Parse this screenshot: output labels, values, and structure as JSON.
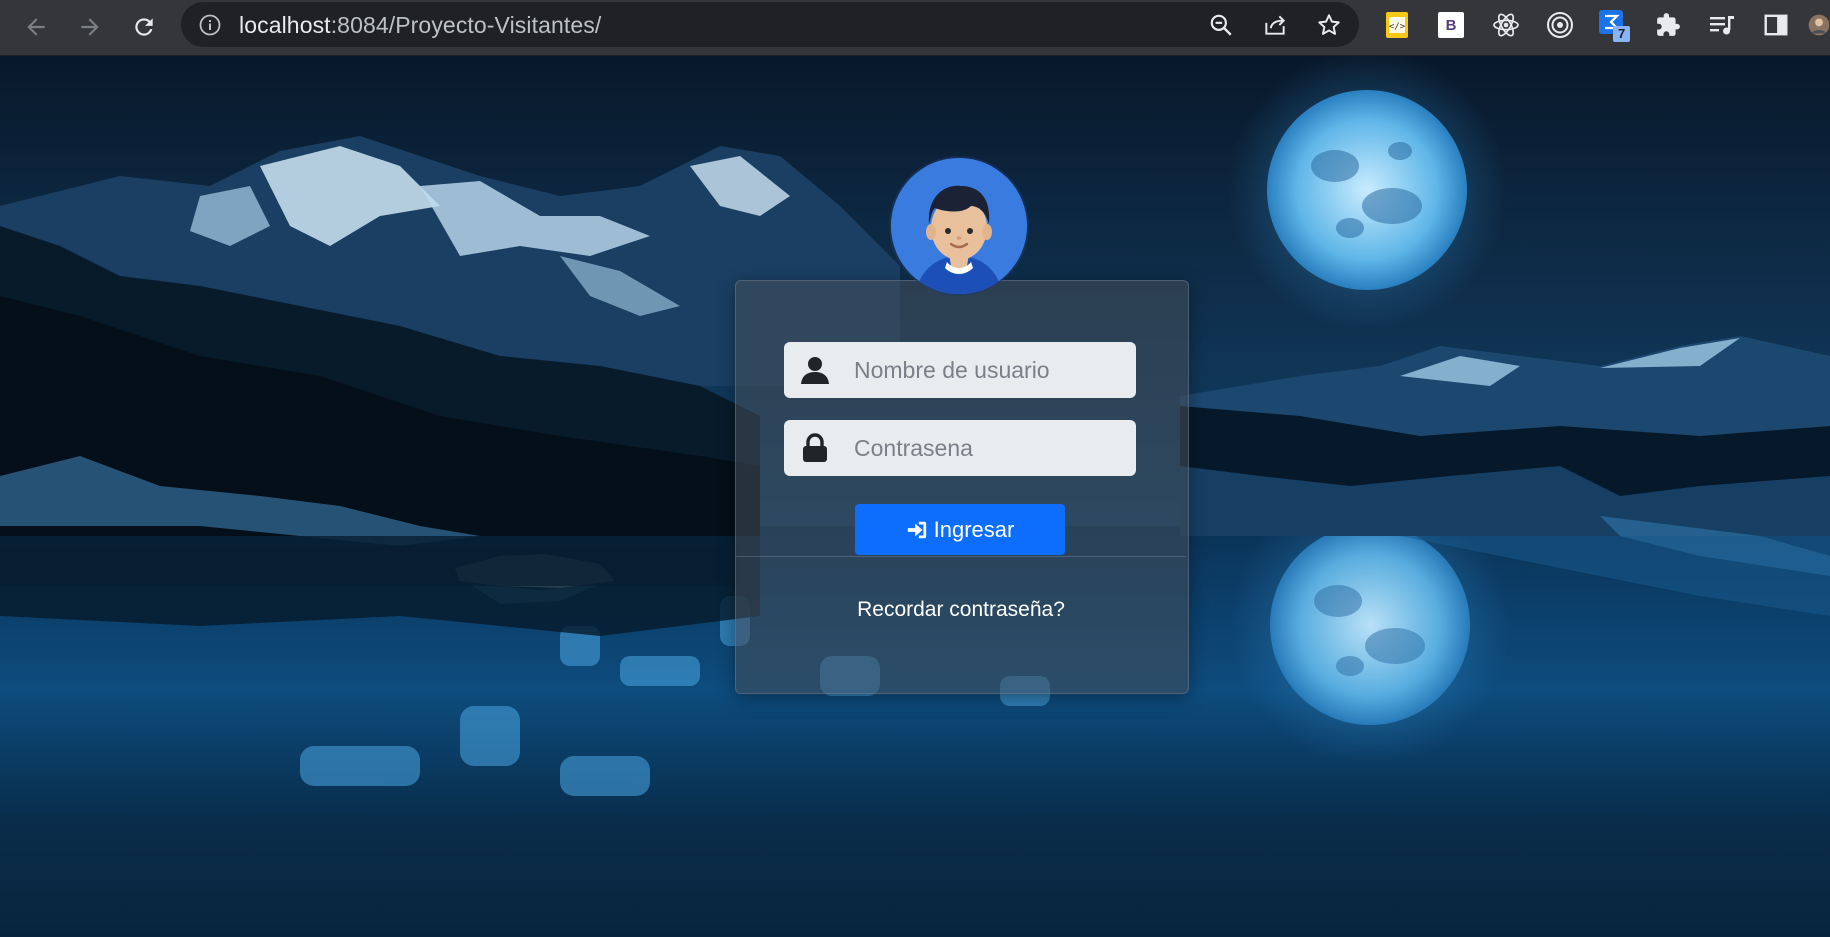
{
  "browser": {
    "url_host": "localhost",
    "url_path": ":8084/Proyecto-Visitantes/",
    "badge_count": "7",
    "bootstrap_ext_letter": "B",
    "nav": {
      "back_icon": "arrow-left-icon",
      "forward_icon": "arrow-right-icon",
      "reload_icon": "reload-icon"
    },
    "omnibox_actions": [
      "zoom-out-icon",
      "share-icon",
      "star-icon"
    ],
    "extensions": [
      "code-extension-icon",
      "bootstrap-extension-icon",
      "react-devtools-icon",
      "target-extension-icon",
      "badge-extension-icon",
      "puzzle-extensions-icon",
      "media-control-icon",
      "side-panel-icon",
      "profile-avatar-icon"
    ]
  },
  "login": {
    "username_placeholder": "Nombre de usuario",
    "password_placeholder": "Contrasena",
    "submit_label": "Ingresar",
    "forgot_label": "Recordar contraseña?",
    "user_icon": "user-icon",
    "lock_icon": "lock-icon",
    "submit_icon": "sign-in-icon"
  },
  "colors": {
    "chrome_bg": "#35363a",
    "omnibox_bg": "#202124",
    "primary_button": "#0d6efd",
    "input_bg": "#e9ecef",
    "avatar_bg": "#3a7be0"
  }
}
